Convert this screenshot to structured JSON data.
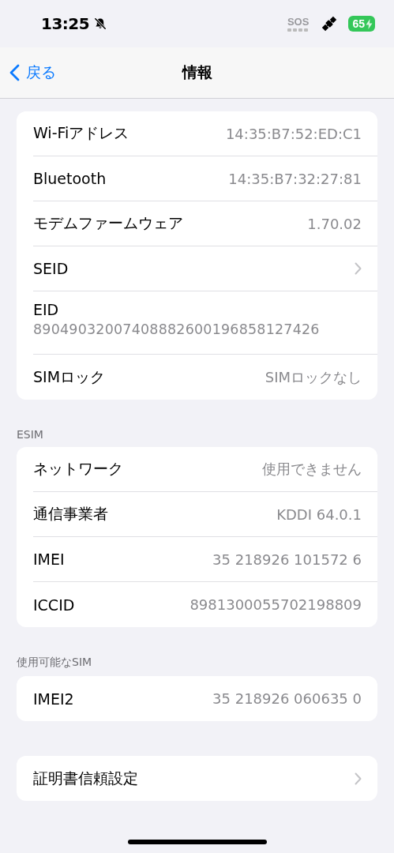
{
  "status_bar": {
    "time": "13:25",
    "silent": true,
    "sos": "SOS",
    "battery": "65",
    "charging": true
  },
  "nav": {
    "back": "戻る",
    "title": "情報"
  },
  "groups": [
    {
      "rows": [
        {
          "kind": "value",
          "label": "Wi-Fiアドレス",
          "value": "14:35:B7:52:ED:C1"
        },
        {
          "kind": "value",
          "label": "Bluetooth",
          "value": "14:35:B7:32:27:81"
        },
        {
          "kind": "value",
          "label": "モデムファームウェア",
          "value": "1.70.02"
        },
        {
          "kind": "link",
          "label": "SEID"
        },
        {
          "kind": "stacked",
          "label": "EID",
          "value": "89049032007408882600196858127426"
        },
        {
          "kind": "value",
          "label": "SIMロック",
          "value": "SIMロックなし"
        }
      ]
    },
    {
      "header": "ESIM",
      "rows": [
        {
          "kind": "value",
          "label": "ネットワーク",
          "value": "使用できません"
        },
        {
          "kind": "value",
          "label": "通信事業者",
          "value": "KDDI 64.0.1"
        },
        {
          "kind": "value",
          "label": "IMEI",
          "value": "35 218926 101572 6"
        },
        {
          "kind": "value",
          "label": "ICCID",
          "value": "8981300055702198809"
        }
      ]
    },
    {
      "header": "使用可能なSIM",
      "rows": [
        {
          "kind": "value",
          "label": "IMEI2",
          "value": "35 218926 060635 0"
        }
      ]
    },
    {
      "rows": [
        {
          "kind": "link",
          "label": "証明書信頼設定"
        }
      ]
    }
  ]
}
